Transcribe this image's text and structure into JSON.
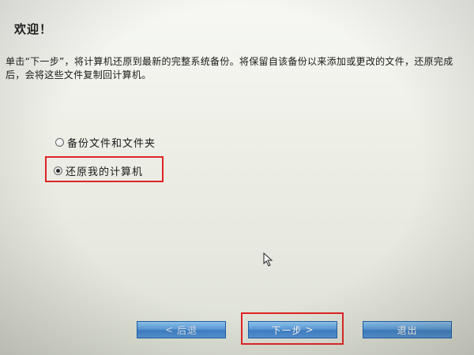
{
  "welcome": {
    "title": "欢迎！"
  },
  "instructions": {
    "text": "单击“下一步”，将计算机还原到最新的完整系统备份。将保留自该备份以来添加或更改的文件，还原完成后，会将这些文件复制回计算机。"
  },
  "options": {
    "backup_files": {
      "label": "备份文件和文件夹",
      "selected": false
    },
    "restore_computer": {
      "label": "还原我的计算机",
      "selected": true
    }
  },
  "buttons": {
    "back_label": "后退",
    "back_prefix": "<",
    "next_label": "下一步",
    "next_suffix": ">",
    "exit_label": "退出"
  },
  "colors": {
    "highlight": "#e02424",
    "button": "#4a8ad0"
  }
}
